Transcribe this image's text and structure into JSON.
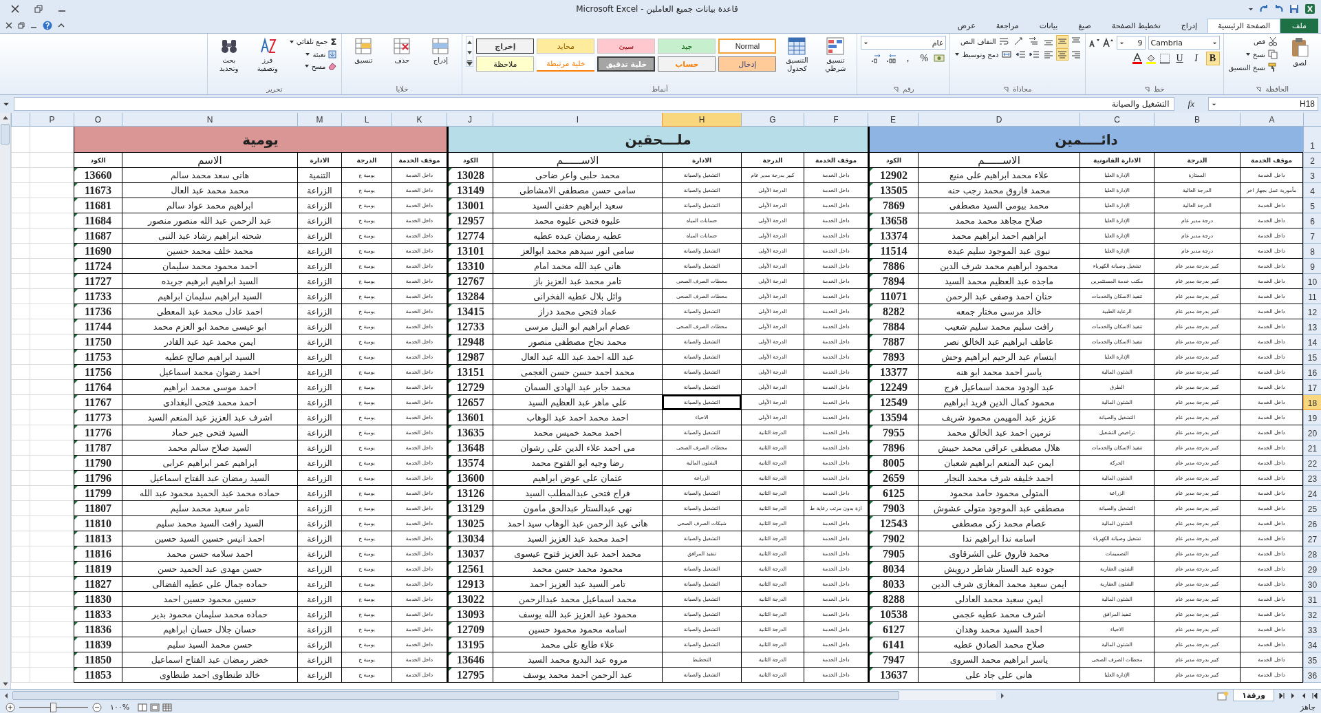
{
  "window": {
    "title": "قاعدة بيانات جميع العاملين - Microsoft Excel"
  },
  "tabs": [
    {
      "label": "ملف",
      "kind": "file",
      "selected": false
    },
    {
      "label": "الصفحة الرئيسية",
      "kind": "tab",
      "selected": true
    },
    {
      "label": "إدراج",
      "kind": "tab",
      "selected": false
    },
    {
      "label": "تخطيط الصفحة",
      "kind": "tab",
      "selected": false
    },
    {
      "label": "صيغ",
      "kind": "tab",
      "selected": false
    },
    {
      "label": "بيانات",
      "kind": "tab",
      "selected": false
    },
    {
      "label": "مراجعة",
      "kind": "tab",
      "selected": false
    },
    {
      "label": "عرض",
      "kind": "tab",
      "selected": false
    }
  ],
  "ribbon": {
    "clipboard": {
      "label": "الحافظة",
      "paste": "لصق",
      "cut": "قص",
      "copy": "نسخ",
      "format_painter": "نسخ التنسيق"
    },
    "font": {
      "label": "خط",
      "font_name": "Cambria",
      "font_size": "9",
      "bold": "B",
      "italic": "I",
      "underline": "U"
    },
    "alignment": {
      "label": "محاذاة",
      "wrap_text": "التفاف النص",
      "merge_center": "دمج وتوسيط"
    },
    "number": {
      "label": "رقم",
      "format": "عام",
      "percent": "%",
      "comma": ","
    },
    "styles": {
      "label": "أنماط",
      "conditional": "تنسيق شرطي",
      "as_table": "التنسيق كجدول",
      "gallery": [
        {
          "label": "Normal",
          "kind": "normal",
          "selected": true
        },
        {
          "label": "جيد",
          "kind": "good",
          "selected": false
        },
        {
          "label": "سيئ",
          "kind": "bad",
          "selected": false
        },
        {
          "label": "محايد",
          "kind": "neutral",
          "selected": false
        },
        {
          "label": "إخراج",
          "kind": "output",
          "selected": false
        },
        {
          "label": "إدخال",
          "kind": "input",
          "selected": false
        },
        {
          "label": "حساب",
          "kind": "calculation",
          "selected": false
        },
        {
          "label": "خلية تدقيق",
          "kind": "check",
          "selected": false
        },
        {
          "label": "خلية مرتبطة",
          "kind": "linked",
          "selected": false
        },
        {
          "label": "ملاحظة",
          "kind": "note",
          "selected": false
        }
      ]
    },
    "cells": {
      "label": "خلايا",
      "insert": "إدراج",
      "delete": "حذف",
      "format": "تنسيق"
    },
    "editing": {
      "label": "تحرير",
      "sigma": "Σ",
      "autosum": "جمع تلقائي",
      "fill": "تعبئة",
      "clear": "مسح",
      "sort": "فرز وتصفية",
      "find": "بحث وتحديد"
    }
  },
  "formula_bar": {
    "name_box": "H18",
    "fx": "fx",
    "content": "التشغيل والصيانة"
  },
  "columns": [
    {
      "letter": "A",
      "selected": false
    },
    {
      "letter": "B",
      "selected": false
    },
    {
      "letter": "C",
      "selected": false
    },
    {
      "letter": "D",
      "selected": false
    },
    {
      "letter": "E",
      "selected": false
    },
    {
      "letter": "F",
      "selected": false
    },
    {
      "letter": "G",
      "selected": false
    },
    {
      "letter": "H",
      "selected": true
    },
    {
      "letter": "I",
      "selected": false
    },
    {
      "letter": "J",
      "selected": false
    },
    {
      "letter": "K",
      "selected": false
    },
    {
      "letter": "L",
      "selected": false
    },
    {
      "letter": "M",
      "selected": false
    },
    {
      "letter": "N",
      "selected": false
    },
    {
      "letter": "O",
      "selected": false
    },
    {
      "letter": "P",
      "selected": false
    }
  ],
  "title_row": {
    "number": "1",
    "sections": [
      {
        "title": "دائــــمين",
        "color": "#8db4e2"
      },
      {
        "title": "ملـــحقين",
        "color": "#b7dee8"
      },
      {
        "title": "يومية",
        "color": "#da9694"
      }
    ]
  },
  "header_row": {
    "number": "2",
    "cells": [
      "موقف الخدمة",
      "الدرجة",
      "الادارة القانونية",
      "الاســــــم",
      "الكود",
      "موقف الخدمة",
      "الدرجة",
      "الادارة",
      "الاســــــم",
      "الكود",
      "موقف الخدمة",
      "الدرجة",
      "الادارة",
      "الاسم",
      "الكود"
    ]
  },
  "rows": [
    {
      "number": "3",
      "selected": false,
      "cells": [
        "داخل الخدمة",
        "الممتازة",
        "الإدارة العليا",
        "علاء محمد ابراهيم على  منيع",
        "12902",
        "داخل الخدمة",
        "كبير بدرجة مدير عام",
        "التشغيل والصيانة",
        "محمد حلبى واعر ضاحى",
        "13028",
        "داخل الخدمة",
        "يومية ج",
        "التنمية",
        "هانى سعد محمد سالم",
        "13660"
      ]
    },
    {
      "number": "4",
      "selected": false,
      "cells": [
        "مأمورية عمل بجهاز اخر",
        "الدرجة العالية",
        "الإدارة العليا",
        "محمد فاروق محمد رجب حنه",
        "13505",
        "داخل الخدمة",
        "الدرجة الأولى",
        "التشغيل والصيانة",
        "سامى حسن مصطفى الامشاطى",
        "13149",
        "داخل الخدمة",
        "يومية ج",
        "الزراعة",
        "محمد محمد عبد العال",
        "11673"
      ]
    },
    {
      "number": "5",
      "selected": false,
      "cells": [
        "داخل الخدمة",
        "الدرجة العالية",
        "الإدارة العليا",
        "محمد بيومى السيد مصطفى",
        "7869",
        "داخل الخدمة",
        "الدرجة الأولى",
        "التشغيل والصيانة",
        "سعيد ابراهيم حفنى السيد",
        "13001",
        "داخل الخدمة",
        "يومية ج",
        "الزراعة",
        "ابراهيم محمد عواد سالم",
        "11681"
      ]
    },
    {
      "number": "6",
      "selected": false,
      "cells": [
        "داخل الخدمة",
        "درجة مدير عام",
        "الإدارة العليا",
        "صلاح مجاهد محمد محمد",
        "13658",
        "داخل الخدمة",
        "الدرجة الأولى",
        "حسابات المياه",
        "عليوه فتحى عليوه محمد",
        "12957",
        "داخل الخدمة",
        "يومية ج",
        "الزراعة",
        "عبد الرحمن عبد الله منصور منصور",
        "11684"
      ]
    },
    {
      "number": "7",
      "selected": false,
      "cells": [
        "داخل الخدمة",
        "درجة مدير عام",
        "الإدارة العليا",
        "ابراهيم احمد ابراهيم محمد",
        "13374",
        "داخل الخدمة",
        "الدرجة الأولى",
        "حسابات المياه",
        "عطيه رمضان عبده عطيه",
        "12774",
        "داخل الخدمة",
        "يومية ج",
        "الزراعة",
        "شحته ابراهيم رشاد عبد النبى",
        "11687"
      ]
    },
    {
      "number": "8",
      "selected": false,
      "cells": [
        "داخل الخدمة",
        "درجة مدير عام",
        "الإدارة العليا",
        "نبوى عبد الموجود سليم عبده",
        "11514",
        "داخل الخدمة",
        "الدرجة الأولى",
        "التشغيل والصيانة",
        "سامى انور سيدهم محمد ابوالعز",
        "13101",
        "داخل الخدمة",
        "يومية ج",
        "الزراعة",
        "محمد خلف محمد حسين",
        "11690"
      ]
    },
    {
      "number": "9",
      "selected": false,
      "cells": [
        "داخل الخدمة",
        "كبير بدرجة مدير عام",
        "تشغيل وصيانة الكهرباء",
        "محمود ابراهيم محمد شرف الدين",
        "7886",
        "داخل الخدمة",
        "الدرجة الأولى",
        "التشغيل والصيانة",
        "هانى عبد الله محمد امام",
        "13310",
        "داخل الخدمة",
        "يومية ج",
        "الزراعة",
        "احمد محمود محمد سليمان",
        "11724"
      ]
    },
    {
      "number": "10",
      "selected": false,
      "cells": [
        "داخل الخدمة",
        "كبير بدرجة مدير عام",
        "مكتب خدمة المستثمرين",
        "ماجده عبد العظيم محمد السيد",
        "7894",
        "داخل الخدمة",
        "الدرجة الأولى",
        "محطات الصرف الصحى",
        "تامر محمد عبد العزيز باز",
        "12767",
        "داخل الخدمة",
        "يومية ج",
        "الزراعة",
        "السيد ابراهيم ابرهيم جريده",
        "11727"
      ]
    },
    {
      "number": "11",
      "selected": false,
      "cells": [
        "داخل الخدمة",
        "كبير بدرجة مدير عام",
        "تنفيذ الاسكان والخدمات",
        "حنان احمد وصفى عبد الرحمن",
        "11071",
        "داخل الخدمة",
        "الدرجة الأولى",
        "محطات الصرف الصحى",
        "وائل بلال عطيه الفخرانى",
        "13284",
        "داخل الخدمة",
        "يومية ج",
        "الزراعة",
        "السيد ابراهيم سليمان ابراهيم",
        "11733"
      ]
    },
    {
      "number": "12",
      "selected": false,
      "cells": [
        "داخل الخدمة",
        "كبير بدرجة مدير عام",
        "الرعاية الطبية",
        "خالد مرسى مختار جمعه",
        "8282",
        "داخل الخدمة",
        "الدرجة الأولى",
        "التشغيل والصيانة",
        "عماد فتحى محمد دراز",
        "13415",
        "داخل الخدمة",
        "يومية ج",
        "الزراعة",
        "احمد عادل محمد عبد المعطى",
        "11736"
      ]
    },
    {
      "number": "13",
      "selected": false,
      "cells": [
        "داخل الخدمة",
        "كبير بدرجة مدير عام",
        "تنفيذ الاسكان والخدمات",
        "رافت سليم محمد سليم شعيب",
        "7884",
        "داخل الخدمة",
        "الدرجة الأولى",
        "محطات الصرف الصحى",
        "عصام ابراهيم ابو النيل مرسى",
        "12733",
        "داخل الخدمة",
        "يومية ج",
        "الزراعة",
        "ابو عيسى محمد ابو العزم محمد",
        "11744"
      ]
    },
    {
      "number": "14",
      "selected": false,
      "cells": [
        "داخل الخدمة",
        "كبير بدرجة مدير عام",
        "تنفيذ الاسكان والخدمات",
        "عاطف ابراهيم عبد الخالق نصر",
        "7887",
        "داخل الخدمة",
        "الدرجة الأولى",
        "التشغيل والصيانة",
        "محمد نجاح مصطفى منصور",
        "12948",
        "داخل الخدمة",
        "يومية ج",
        "الزراعة",
        "ايمن محمد عيد عبد القادر",
        "11750"
      ]
    },
    {
      "number": "15",
      "selected": false,
      "cells": [
        "داخل الخدمة",
        "كبير بدرجة مدير عام",
        "الإدارة العليا",
        "ابتسام عبد الرحيم ابراهيم وحش",
        "7893",
        "داخل الخدمة",
        "الدرجة الأولى",
        "التشغيل والصيانة",
        "عبد الله احمد عبد الله عبد العال",
        "12987",
        "داخل الخدمة",
        "يومية ج",
        "الزراعة",
        "السيد ابراهيم صالح عطيه",
        "11753"
      ]
    },
    {
      "number": "16",
      "selected": false,
      "cells": [
        "داخل الخدمة",
        "كبير بدرجة مدير عام",
        "الشئون المالية",
        "ياسر احمد محمد ابو هنه",
        "13377",
        "داخل الخدمة",
        "الدرجة الأولى",
        "التشغيل والصيانة",
        "محمد احمد حسن حسن العجمى",
        "13151",
        "داخل الخدمة",
        "يومية ج",
        "الزراعة",
        "احمد رضوان محمد اسماعيل",
        "11756"
      ]
    },
    {
      "number": "17",
      "selected": false,
      "cells": [
        "داخل الخدمة",
        "كبير بدرجة مدير عام",
        "الطرق",
        "عبد الودود محمد اسماعيل فرج",
        "12249",
        "داخل الخدمة",
        "الدرجة الأولى",
        "التشغيل والصيانة",
        "محمد جابر عبد الهادى السمان",
        "12729",
        "داخل الخدمة",
        "يومية ج",
        "الزراعة",
        "احمد موسى محمد ابراهيم",
        "11764"
      ]
    },
    {
      "number": "18",
      "selected": true,
      "cells": [
        "داخل الخدمة",
        "كبير بدرجة مدير عام",
        "الشئون المالية",
        "محمود كمال الدين فريد ابراهيم",
        "12549",
        "داخل الخدمة",
        "الدرجة الأولى",
        "التشغيل والصيانة",
        "على ماهر عبد العظيم السيد",
        "12657",
        "داخل الخدمة",
        "يومية ج",
        "الزراعة",
        "احمد محمد فتحى البغدادى",
        "11767"
      ]
    },
    {
      "number": "19",
      "selected": false,
      "cells": [
        "داخل الخدمة",
        "كبير بدرجة مدير عام",
        "التشغيل والصيانة",
        "عزيز عبد المهيمن محمود شريف",
        "13594",
        "داخل الخدمة",
        "الدرجة الأولى",
        "الاحياء",
        "احمد محمد احمد عبد الوهاب",
        "13601",
        "داخل الخدمة",
        "يومية ج",
        "الزراعة",
        "اشرف عبد العزيز عبد المنعم السيد",
        "11773"
      ]
    },
    {
      "number": "20",
      "selected": false,
      "cells": [
        "داخل الخدمة",
        "كبير بدرجة مدير عام",
        "تراخيص التشغيل",
        "نرمين احمد عبد الخالق محمد",
        "7955",
        "داخل الخدمة",
        "الدرجة الثانية",
        "التشغيل والصيانة",
        "احمد محمد خميس محمد",
        "13635",
        "داخل الخدمة",
        "يومية ج",
        "الزراعة",
        "السيد فتحى جبر حماد",
        "11776"
      ]
    },
    {
      "number": "21",
      "selected": false,
      "cells": [
        "داخل الخدمة",
        "كبير بدرجة مدير عام",
        "تنفيذ الاسكان والخدمات",
        "هلال مصطفى عراقى محمد حبيش",
        "7896",
        "داخل الخدمة",
        "الدرجة الثانية",
        "محطات الصرف الصحى",
        "مى احمد علاء الدين على رشوان",
        "13648",
        "داخل الخدمة",
        "يومية ج",
        "الزراعة",
        "السيد صلاح سالم محمد",
        "11787"
      ]
    },
    {
      "number": "22",
      "selected": false,
      "cells": [
        "داخل الخدمة",
        "كبير بدرجة مدير عام",
        "الحركة",
        "ايمن عبد المنعم ابراهيم شعبان",
        "8005",
        "داخل الخدمة",
        "الدرجة الثانية",
        "الشئون المالية",
        "رضا وجيه ابو الفتوح محمد",
        "13574",
        "داخل الخدمة",
        "يومية ج",
        "الزراعة",
        "ابراهيم عمر ابراهيم عرابى",
        "11790"
      ]
    },
    {
      "number": "23",
      "selected": false,
      "cells": [
        "داخل الخدمة",
        "كبير بدرجة مدير عام",
        "الشئون المالية",
        "احمد خليفه شرف محمد النجار",
        "2659",
        "داخل الخدمة",
        "الدرجة الثانية",
        "الزراعة",
        "عثمان على عوض ابراهيم",
        "13600",
        "داخل الخدمة",
        "يومية ج",
        "الزراعة",
        "السيد رمضان عبد الفتاح اسماعيل",
        "11796"
      ]
    },
    {
      "number": "24",
      "selected": false,
      "cells": [
        "داخل الخدمة",
        "كبير بدرجة مدير عام",
        "الزراعة",
        "المتولى محمود حامد محمود",
        "6125",
        "داخل الخدمة",
        "الدرجة الثانية",
        "التشغيل والصيانة",
        "فراج فتحى عبدالمطلب السيد",
        "13126",
        "داخل الخدمة",
        "يومية ج",
        "الزراعة",
        "حماده محمد عبد الحميد محمود عبد الله",
        "11799"
      ]
    },
    {
      "number": "25",
      "selected": false,
      "cells": [
        "داخل الخدمة",
        "كبير بدرجة مدير عام",
        "التشغيل والصيانة",
        "مصطفى عبد الموجود متولى عشوش",
        "7903",
        "ازة بدون مرتب رعاية ط",
        "الدرجة الثانية",
        "التشغيل والصيانة",
        "نهى عبدالستار عبدالحق مامون",
        "13129",
        "داخل الخدمة",
        "يومية ج",
        "الزراعة",
        "تامر سعيد محمد سليم",
        "11807"
      ]
    },
    {
      "number": "26",
      "selected": false,
      "cells": [
        "داخل الخدمة",
        "كبير بدرجة مدير عام",
        "الشئون المالية",
        "عصام محمد زكى مصطفى",
        "12543",
        "داخل الخدمة",
        "الدرجة الثانية",
        "شبكات الصرف الصحى",
        "هانى عبد الرحمن عبد الوهاب سيد احمد",
        "13025",
        "داخل الخدمة",
        "يومية ج",
        "الزراعة",
        "السيد رافت السيد محمد سليم",
        "11810"
      ]
    },
    {
      "number": "27",
      "selected": false,
      "cells": [
        "داخل الخدمة",
        "كبير بدرجة مدير عام",
        "تشغيل وصيانة الكهرباء",
        "اسامه ندا ابراهيم ندا",
        "7902",
        "داخل الخدمة",
        "الدرجة الثانية",
        "التشغيل والصيانة",
        "احمد محمد عبد العزيز السيد",
        "13034",
        "داخل الخدمة",
        "يومية ج",
        "الزراعة",
        "احمد انيس حسين السيد حسين",
        "11813"
      ]
    },
    {
      "number": "28",
      "selected": false,
      "cells": [
        "داخل الخدمة",
        "كبير بدرجة مدير عام",
        "التصميمات",
        "محمد فاروق على الشرقاوى",
        "7905",
        "داخل الخدمة",
        "الدرجة الثانية",
        "تنفيذ المرافق",
        "محمد احمد عبد العزيز فتوح عيسوى",
        "13037",
        "داخل الخدمة",
        "يومية ج",
        "الزراعة",
        "احمد سلامه حسن محمد",
        "11816"
      ]
    },
    {
      "number": "29",
      "selected": false,
      "cells": [
        "داخل الخدمة",
        "كبير بدرجة مدير عام",
        "الشئون العقارية",
        "جوده عبد الستار شاطر درويش",
        "8034",
        "داخل الخدمة",
        "الدرجة الثانية",
        "التشغيل والصيانة",
        "محمود محمد حسن محمد",
        "12561",
        "داخل الخدمة",
        "يومية ج",
        "الزراعة",
        "حسن مهدى عبد الحميد حسن",
        "11819"
      ]
    },
    {
      "number": "30",
      "selected": false,
      "cells": [
        "داخل الخدمة",
        "كبير بدرجة مدير عام",
        "الشئون العقارية",
        "ايمن سعيد محمد المغازى شرف الدين",
        "8033",
        "داخل الخدمة",
        "الدرجة الثانية",
        "التشغيل والصيانة",
        "تامر السيد عبد العزيز احمد",
        "12913",
        "داخل الخدمة",
        "يومية ج",
        "الزراعة",
        "حماده جمال على عطيه الفضالى",
        "11827"
      ]
    },
    {
      "number": "31",
      "selected": false,
      "cells": [
        "داخل الخدمة",
        "كبير بدرجة مدير عام",
        "الشئون المالية",
        "ايمن سعيد محمد العادلى",
        "8288",
        "داخل الخدمة",
        "الدرجة الثانية",
        "التشغيل والصيانة",
        "محمد اسماعيل محمد عبدالرحمن",
        "13022",
        "داخل الخدمة",
        "يومية ج",
        "الزراعة",
        "حسين محمود حسين احمد",
        "11830"
      ]
    },
    {
      "number": "32",
      "selected": false,
      "cells": [
        "داخل الخدمة",
        "كبير بدرجة مدير عام",
        "تنفيذ المرافق",
        "اشرف محمد عطيه عجمى",
        "10538",
        "داخل الخدمة",
        "الدرجة الثانية",
        "التشغيل والصيانة",
        "محمود عبد العزيز عبد الله يوسف",
        "13093",
        "داخل الخدمة",
        "يومية ج",
        "الزراعة",
        "حماده محمد سليمان محمود بدير",
        "11833"
      ]
    },
    {
      "number": "33",
      "selected": false,
      "cells": [
        "داخل الخدمة",
        "كبير بدرجة مدير عام",
        "الاحياء",
        "احمد السيد محمد وهدان",
        "6127",
        "داخل الخدمة",
        "الدرجة الثانية",
        "التشغيل والصيانة",
        "اسامه محمود محمود حسين",
        "12709",
        "داخل الخدمة",
        "يومية ج",
        "الزراعة",
        "حسان جلال حسان ابراهيم",
        "11836"
      ]
    },
    {
      "number": "34",
      "selected": false,
      "cells": [
        "داخل الخدمة",
        "كبير بدرجة مدير عام",
        "الشئون المالية",
        "صلاح محمد الصادق عطيه",
        "6141",
        "داخل الخدمة",
        "الدرجة الثانية",
        "التشغيل والصيانة",
        "علاء طايع على محمد",
        "13195",
        "داخل الخدمة",
        "يومية ج",
        "الزراعة",
        "حسن محمد السيد سليم",
        "11839"
      ]
    },
    {
      "number": "35",
      "selected": false,
      "cells": [
        "داخل الخدمة",
        "كبير بدرجة مدير عام",
        "محطات الصرف الصحى",
        "ياسر ابراهيم محمد السروى",
        "7947",
        "داخل الخدمة",
        "الدرجة الثانية",
        "التخطيط",
        "مروه عبد البديع محمد السيد",
        "13646",
        "داخل الخدمة",
        "يومية ج",
        "الزراعة",
        "خضر رمضان عبد الفتاح اسماعيل",
        "11850"
      ]
    },
    {
      "number": "36",
      "selected": false,
      "cells": [
        "داخل الخدمة",
        "كبير بدرجة مدير عام",
        "الإدارة العليا",
        "هانى على جاد على",
        "13637",
        "داخل الخدمة",
        "الدرجة الثانية",
        "التشغيل والصيانة",
        "عبد الرحمن احمد محمد يوسف",
        "12795",
        "داخل الخدمة",
        "يومية ج",
        "الزراعة",
        "خالد طنطاوى احمد طنطاوى",
        "11853"
      ]
    }
  ],
  "sheet_tabs": [
    {
      "label": "ورقة١",
      "selected": true
    }
  ],
  "status_bar": {
    "status": "جاهز",
    "zoom": "%١٠٠",
    "zoom_slider": {
      "level": 0.5
    }
  }
}
